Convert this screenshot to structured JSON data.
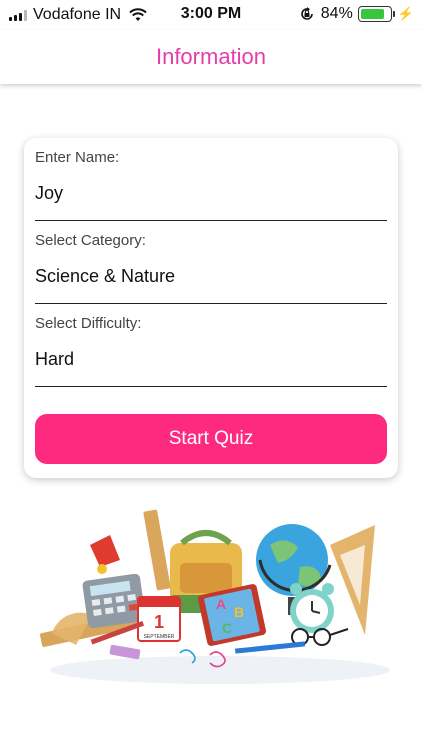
{
  "status_bar": {
    "carrier": "Vodafone IN",
    "time": "3:00 PM",
    "battery_percent": "84%",
    "battery_level": 0.84,
    "colors": {
      "battery_fill": "#38c73c"
    }
  },
  "nav": {
    "title": "Information",
    "title_color": "#e43cab"
  },
  "form": {
    "name": {
      "label": "Enter Name:",
      "value": "Joy"
    },
    "category": {
      "label": "Select Category:",
      "value": "Science & Nature"
    },
    "difficulty": {
      "label": "Select Difficulty:",
      "value": "Hard"
    },
    "start_button": {
      "label": "Start Quiz",
      "color": "#fd2a7f"
    }
  },
  "illustration": {
    "icon": "school-supplies-illustration",
    "book_letters": [
      "A",
      "B",
      "C"
    ],
    "calendar_day": "1",
    "calendar_month": "SEPTEMBER"
  }
}
